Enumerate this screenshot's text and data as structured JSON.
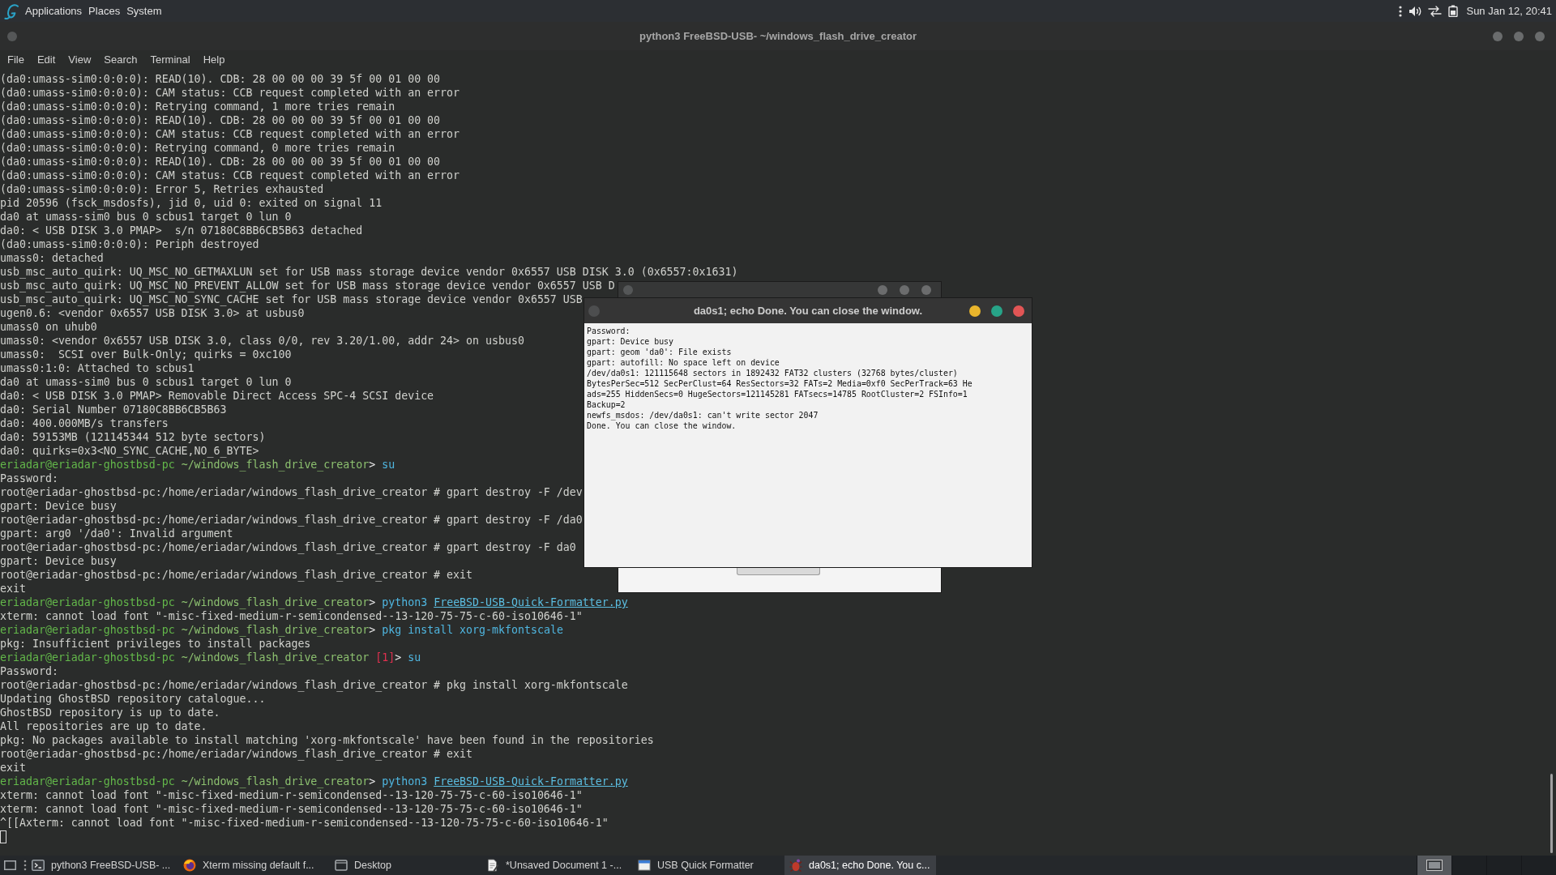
{
  "top_panel": {
    "menus": [
      "Applications",
      "Places",
      "System"
    ],
    "clock": "Sun Jan 12, 20:41"
  },
  "terminal": {
    "title": "python3 FreeBSD-USB- ~/windows_flash_drive_creator",
    "menu": [
      "File",
      "Edit",
      "View",
      "Search",
      "Terminal",
      "Help"
    ],
    "lines": [
      {
        "kind": "output",
        "text": "(da0:umass-sim0:0:0:0): READ(10). CDB: 28 00 00 00 39 5f 00 01 00 00"
      },
      {
        "kind": "output",
        "text": "(da0:umass-sim0:0:0:0): CAM status: CCB request completed with an error"
      },
      {
        "kind": "output",
        "text": "(da0:umass-sim0:0:0:0): Retrying command, 1 more tries remain"
      },
      {
        "kind": "output",
        "text": "(da0:umass-sim0:0:0:0): READ(10). CDB: 28 00 00 00 39 5f 00 01 00 00"
      },
      {
        "kind": "output",
        "text": "(da0:umass-sim0:0:0:0): CAM status: CCB request completed with an error"
      },
      {
        "kind": "output",
        "text": "(da0:umass-sim0:0:0:0): Retrying command, 0 more tries remain"
      },
      {
        "kind": "output",
        "text": "(da0:umass-sim0:0:0:0): READ(10). CDB: 28 00 00 00 39 5f 00 01 00 00"
      },
      {
        "kind": "output",
        "text": "(da0:umass-sim0:0:0:0): CAM status: CCB request completed with an error"
      },
      {
        "kind": "output",
        "text": "(da0:umass-sim0:0:0:0): Error 5, Retries exhausted"
      },
      {
        "kind": "output",
        "text": "pid 20596 (fsck_msdosfs), jid 0, uid 0: exited on signal 11"
      },
      {
        "kind": "output",
        "text": "da0 at umass-sim0 bus 0 scbus1 target 0 lun 0"
      },
      {
        "kind": "output",
        "text": "da0: < USB DISK 3.0 PMAP>  s/n 07180C8BB6CB5B63 detached"
      },
      {
        "kind": "output",
        "text": "(da0:umass-sim0:0:0:0): Periph destroyed"
      },
      {
        "kind": "output",
        "text": "umass0: detached"
      },
      {
        "kind": "output",
        "text": "usb_msc_auto_quirk: UQ_MSC_NO_GETMAXLUN set for USB mass storage device vendor 0x6557 USB DISK 3.0 (0x6557:0x1631)"
      },
      {
        "kind": "output",
        "text": "usb_msc_auto_quirk: UQ_MSC_NO_PREVENT_ALLOW set for USB mass storage device vendor 0x6557 USB D"
      },
      {
        "kind": "output",
        "text": "usb_msc_auto_quirk: UQ_MSC_NO_SYNC_CACHE set for USB mass storage device vendor 0x6557 USB"
      },
      {
        "kind": "output",
        "text": "ugen0.6: <vendor 0x6557 USB DISK 3.0> at usbus0"
      },
      {
        "kind": "output",
        "text": "umass0 on uhub0"
      },
      {
        "kind": "output",
        "text": "umass0: <vendor 0x6557 USB DISK 3.0, class 0/0, rev 3.20/1.00, addr 24> on usbus0"
      },
      {
        "kind": "output",
        "text": "umass0:  SCSI over Bulk-Only; quirks = 0xc100"
      },
      {
        "kind": "output",
        "text": "umass0:1:0: Attached to scbus1"
      },
      {
        "kind": "output",
        "text": "da0 at umass-sim0 bus 0 scbus1 target 0 lun 0"
      },
      {
        "kind": "output",
        "text": "da0: < USB DISK 3.0 PMAP> Removable Direct Access SPC-4 SCSI device"
      },
      {
        "kind": "output",
        "text": "da0: Serial Number 07180C8BB6CB5B63"
      },
      {
        "kind": "output",
        "text": "da0: 400.000MB/s transfers"
      },
      {
        "kind": "output",
        "text": "da0: 59153MB (121145344 512 byte sectors)"
      },
      {
        "kind": "output",
        "text": "da0: quirks=0x3<NO_SYNC_CACHE,NO_6_BYTE>"
      },
      {
        "kind": "prompt",
        "parts": [
          {
            "kind": "user",
            "text": "eriadar@eriadar-ghostbsd-pc"
          },
          {
            "kind": "cwd",
            "text": "~/windows_flash_drive_creator"
          },
          {
            "kind": "symbol",
            "text": ">"
          },
          {
            "kind": "command",
            "text": "su"
          }
        ]
      },
      {
        "kind": "output",
        "text": "Password:"
      },
      {
        "kind": "output",
        "text": "root@eriadar-ghostbsd-pc:/home/eriadar/windows_flash_drive_creator # gpart destroy -F /dev"
      },
      {
        "kind": "output",
        "text": "gpart: Device busy"
      },
      {
        "kind": "output",
        "text": "root@eriadar-ghostbsd-pc:/home/eriadar/windows_flash_drive_creator # gpart destroy -F /da0"
      },
      {
        "kind": "output",
        "text": "gpart: arg0 '/da0': Invalid argument"
      },
      {
        "kind": "output",
        "text": "root@eriadar-ghostbsd-pc:/home/eriadar/windows_flash_drive_creator # gpart destroy -F da0"
      },
      {
        "kind": "output",
        "text": "gpart: Device busy"
      },
      {
        "kind": "output",
        "text": "root@eriadar-ghostbsd-pc:/home/eriadar/windows_flash_drive_creator # exit"
      },
      {
        "kind": "output",
        "text": "exit"
      },
      {
        "kind": "prompt",
        "parts": [
          {
            "kind": "user",
            "text": "eriadar@eriadar-ghostbsd-pc"
          },
          {
            "kind": "cwd",
            "text": "~/windows_flash_drive_creator"
          },
          {
            "kind": "symbol",
            "text": ">"
          },
          {
            "kind": "command",
            "text": "python3"
          },
          {
            "kind": "path",
            "text": "FreeBSD-USB-Quick-Formatter.py"
          }
        ]
      },
      {
        "kind": "output",
        "text": "xterm: cannot load font \"-misc-fixed-medium-r-semicondensed--13-120-75-75-c-60-iso10646-1\""
      },
      {
        "kind": "prompt",
        "parts": [
          {
            "kind": "user",
            "text": "eriadar@eriadar-ghostbsd-pc"
          },
          {
            "kind": "cwd",
            "text": "~/windows_flash_drive_creator"
          },
          {
            "kind": "symbol",
            "text": ">"
          },
          {
            "kind": "command",
            "text": "pkg install xorg-mkfontscale"
          }
        ]
      },
      {
        "kind": "output",
        "text": "pkg: Insufficient privileges to install packages"
      },
      {
        "kind": "prompt",
        "parts": [
          {
            "kind": "user",
            "text": "eriadar@eriadar-ghostbsd-pc"
          },
          {
            "kind": "cwd",
            "text": "~/windows_flash_drive_creator"
          },
          {
            "kind": "status",
            "text": "[1]"
          },
          {
            "kind": "symbol",
            "text": ">"
          },
          {
            "kind": "command",
            "text": "su"
          }
        ]
      },
      {
        "kind": "output",
        "text": "Password:"
      },
      {
        "kind": "output",
        "text": "root@eriadar-ghostbsd-pc:/home/eriadar/windows_flash_drive_creator # pkg install xorg-mkfontscale"
      },
      {
        "kind": "output",
        "text": "Updating GhostBSD repository catalogue..."
      },
      {
        "kind": "output",
        "text": "GhostBSD repository is up to date."
      },
      {
        "kind": "output",
        "text": "All repositories are up to date."
      },
      {
        "kind": "output",
        "text": "pkg: No packages available to install matching 'xorg-mkfontscale' have been found in the repositories"
      },
      {
        "kind": "output",
        "text": "root@eriadar-ghostbsd-pc:/home/eriadar/windows_flash_drive_creator # exit"
      },
      {
        "kind": "output",
        "text": "exit"
      },
      {
        "kind": "prompt",
        "parts": [
          {
            "kind": "user",
            "text": "eriadar@eriadar-ghostbsd-pc"
          },
          {
            "kind": "cwd",
            "text": "~/windows_flash_drive_creator"
          },
          {
            "kind": "symbol",
            "text": ">"
          },
          {
            "kind": "command",
            "text": "python3"
          },
          {
            "kind": "path",
            "text": "FreeBSD-USB-Quick-Formatter.py"
          }
        ]
      },
      {
        "kind": "output",
        "text": "xterm: cannot load font \"-misc-fixed-medium-r-semicondensed--13-120-75-75-c-60-iso10646-1\""
      },
      {
        "kind": "output",
        "text": "xterm: cannot load font \"-misc-fixed-medium-r-semicondensed--13-120-75-75-c-60-iso10646-1\""
      },
      {
        "kind": "output",
        "text": "^[[Axterm: cannot load font \"-misc-fixed-medium-r-semicondensed--13-120-75-75-c-60-iso10646-1\""
      }
    ]
  },
  "dialog": {
    "title": "da0s1; echo Done. You can close the window.",
    "lines": [
      "Password:",
      "gpart: Device busy",
      "gpart: geom 'da0': File exists",
      "gpart: autofill: No space left on device",
      "/dev/da0s1: 121115648 sectors in 1892432 FAT32 clusters (32768 bytes/cluster)",
      "BytesPerSec=512 SecPerClust=64 ResSectors=32 FATs=2 Media=0xf0 SecPerTrack=63 He",
      "ads=255 HiddenSecs=0 HugeSectors=121145281 FATsecs=14785 RootCluster=2 FSInfo=1",
      "Backup=2",
      "newfs_msdos: /dev/da0s1: can't write sector 2047",
      "Done. You can close the window."
    ]
  },
  "taskbar": {
    "items": [
      {
        "kind": "terminal",
        "label": "python3 FreeBSD-USB- ...",
        "selected": false
      },
      {
        "kind": "browser",
        "label": "Xterm missing default f...",
        "selected": false
      },
      {
        "kind": "desktop",
        "label": "Desktop",
        "selected": false
      },
      {
        "kind": "editor",
        "label": "*Unsaved Document 1 -...",
        "selected": false
      },
      {
        "kind": "window",
        "label": "USB Quick Formatter",
        "selected": false
      },
      {
        "kind": "xterm",
        "label": "da0s1; echo Done. You c...",
        "selected": true
      }
    ],
    "workspaces": [
      {
        "selected": true
      },
      {
        "selected": false
      },
      {
        "selected": false
      },
      {
        "selected": false
      }
    ]
  }
}
